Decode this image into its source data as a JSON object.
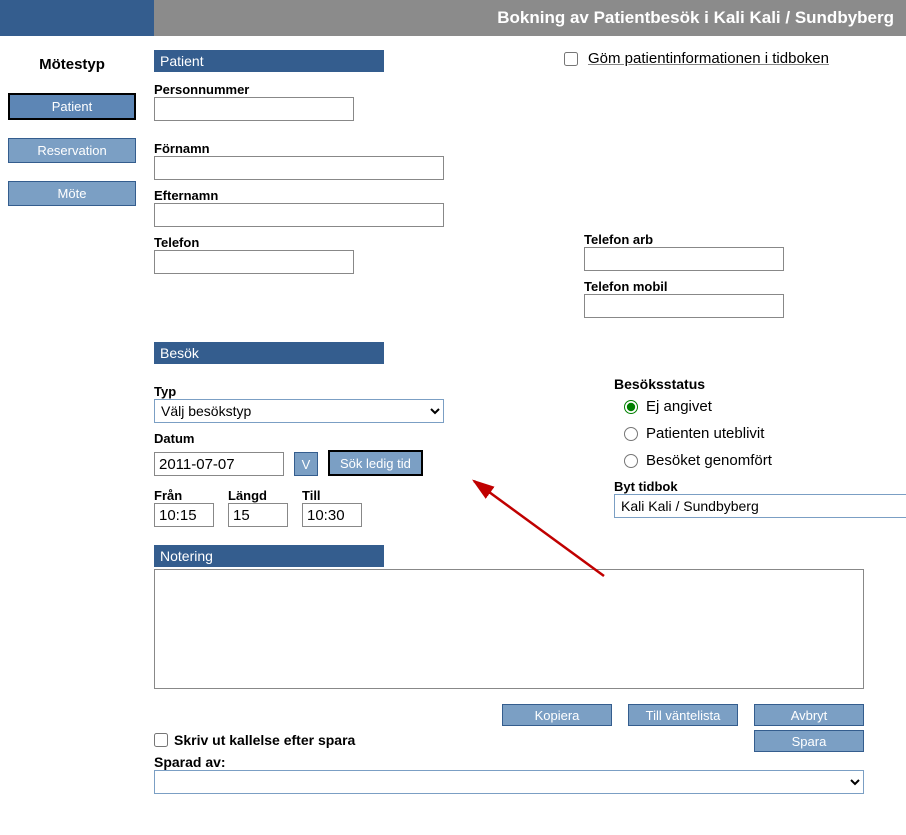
{
  "header": {
    "title": "Bokning av Patientbesök  i Kali Kali / Sundbyberg"
  },
  "sidebar": {
    "title": "Mötestyp",
    "items": [
      {
        "label": "Patient",
        "active": true
      },
      {
        "label": "Reservation",
        "active": false
      },
      {
        "label": "Möte",
        "active": false
      }
    ]
  },
  "sections": {
    "patient": "Patient",
    "visit": "Besök",
    "notes": "Notering"
  },
  "hide_checkbox_label": "Göm patientinformationen i tidboken",
  "patient_fields": {
    "personnummer": {
      "label": "Personnummer",
      "value": ""
    },
    "fornamn": {
      "label": "Förnamn",
      "value": ""
    },
    "efternamn": {
      "label": "Efternamn",
      "value": ""
    },
    "telefon": {
      "label": "Telefon",
      "value": ""
    },
    "telefon_arb": {
      "label": "Telefon arb",
      "value": ""
    },
    "telefon_mobil": {
      "label": "Telefon mobil",
      "value": ""
    }
  },
  "visit": {
    "typ_label": "Typ",
    "typ_value": "Välj besökstyp",
    "datum_label": "Datum",
    "datum_value": "2011-07-07",
    "v_btn": "V",
    "search_btn": "Sök ledig tid",
    "fran_label": "Från",
    "fran_value": "10:15",
    "langd_label": "Längd",
    "langd_value": "15",
    "till_label": "Till",
    "till_value": "10:30"
  },
  "status": {
    "title": "Besöksstatus",
    "options": [
      {
        "label": "Ej angivet",
        "checked": true
      },
      {
        "label": "Patienten uteblivit",
        "checked": false
      },
      {
        "label": "Besöket genomfört",
        "checked": false
      }
    ],
    "tidbok_label": "Byt tidbok",
    "tidbok_value": "Kali Kali / Sundbyberg"
  },
  "notes_value": "",
  "buttons": {
    "kopiera": "Kopiera",
    "vantelista": "Till väntelista",
    "avbryt": "Avbryt",
    "spara": "Spara"
  },
  "print_label": "Skriv ut kallelse efter spara",
  "saved_by_label": "Sparad av:"
}
